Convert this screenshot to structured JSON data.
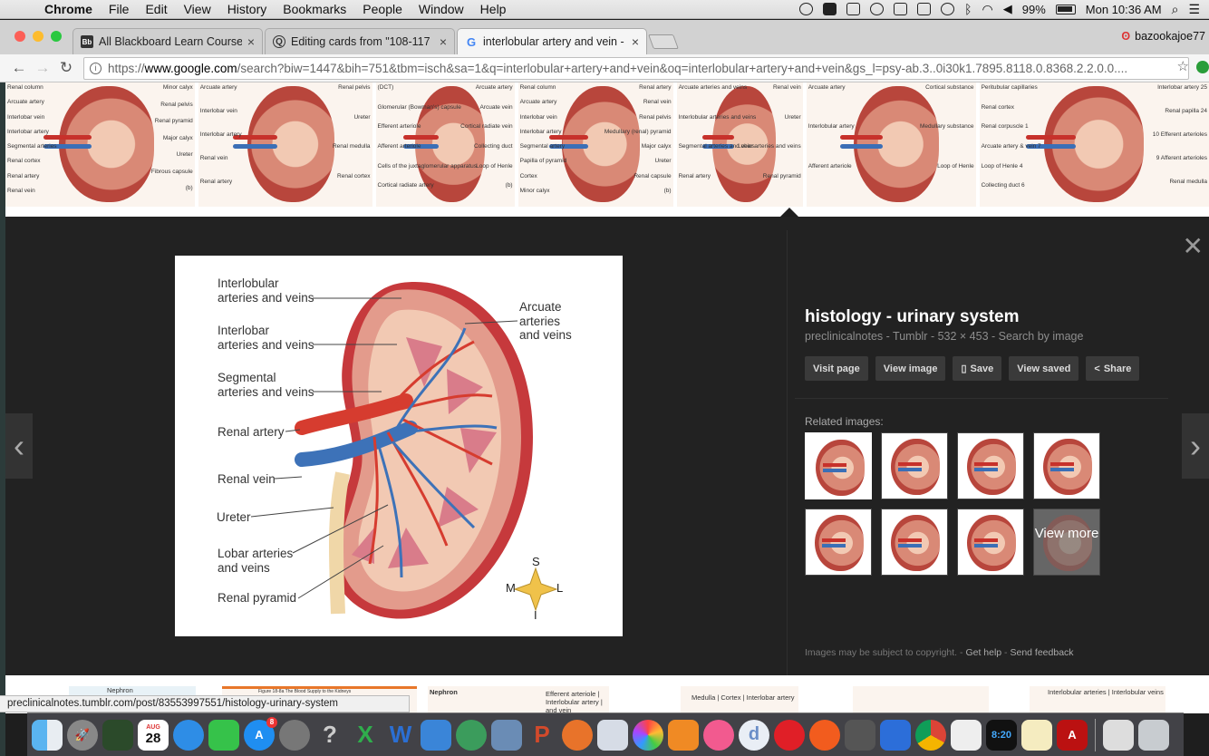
{
  "menubar": {
    "app": "Chrome",
    "items": [
      "File",
      "Edit",
      "View",
      "History",
      "Bookmarks",
      "People",
      "Window",
      "Help"
    ],
    "battery": "99%",
    "clock": "Mon 10:36 AM"
  },
  "tabs": [
    {
      "title": "All Blackboard Learn Courses",
      "favicon": "Bb"
    },
    {
      "title": "Editing cards from \"108-117",
      "favicon": "Q"
    },
    {
      "title": "interlobular artery and vein - G",
      "favicon": "G"
    }
  ],
  "profile": "bazookajoe77",
  "omnibox": {
    "scheme": "https://",
    "host": "www.google.com",
    "path": "/search?biw=1447&bih=751&tbm=isch&sa=1&q=interlobular+artery+and+vein&oq=interlobular+artery+and+vein&gs_l=psy-ab.3..0i30k1.7895.8118.0.8368.2.2.0.0...."
  },
  "top_thumbnails": [
    {
      "labels": [
        "Renal column",
        "Arcuate artery",
        "Interlobar vein",
        "Interlobar artery",
        "Segmental arteries",
        "Renal cortex",
        "Renal artery",
        "Renal vein",
        "Minor calyx",
        "Renal pelvis",
        "Renal pyramid",
        "Major calyx",
        "Ureter",
        "Fibrous capsule",
        "(b)"
      ]
    },
    {
      "labels": [
        "Arcuate artery",
        "Interlobar vein",
        "Interlobar artery",
        "Renal vein",
        "Renal artery",
        "Renal pelvis",
        "Ureter",
        "Renal medulla",
        "Renal cortex"
      ]
    },
    {
      "labels": [
        "(DCT)",
        "Glomerular (Bowman's) capsule",
        "Efferent arteriole",
        "Afferent arteriole",
        "Cells of the juxtaglomerular apparatus",
        "Cortical radiate artery",
        "Arcuate artery",
        "Arcuate vein",
        "Cortical radiate vein",
        "Collecting duct",
        "Loop of Henle",
        "(b)"
      ]
    },
    {
      "labels": [
        "Renal column",
        "Arcuate artery",
        "Interlobar vein",
        "Interlobar artery",
        "Segmental artery",
        "Papilla of pyramid",
        "Cortex",
        "Minor calyx",
        "Renal artery",
        "Renal vein",
        "Renal pelvis",
        "Medullary (renal) pyramid",
        "Major calyx",
        "Ureter",
        "Renal capsule",
        "(b)"
      ]
    },
    {
      "labels": [
        "Arcuate arteries and veins",
        "Interlobular arteries and veins",
        "Segmental arteries and veins",
        "Renal artery",
        "Renal vein",
        "Ureter",
        "Lobar arteries and veins",
        "Renal pyramid"
      ]
    },
    {
      "labels": [
        "Arcuate artery",
        "Interlobular artery",
        "Afferent arteriole",
        "Cortical substance",
        "Medullary substance",
        "Loop of Henle"
      ]
    },
    {
      "labels": [
        "Peritubular capillaries",
        "Renal cortex",
        "Renal corpuscle 1",
        "Arcuate artery & vein 7",
        "Loop of Henle 4",
        "Collecting duct 6",
        "Interlobar artery 25",
        "Renal papilla 24",
        "10 Efferent arterioles",
        "9 Afferent arterioles",
        "Renal medulla"
      ]
    }
  ],
  "viewer": {
    "title": "histology - urinary system",
    "meta": "preclinicalnotes - Tumblr - 532 × 453 - Search by image",
    "buttons": [
      "Visit page",
      "View image",
      "Save",
      "View saved",
      "Share"
    ],
    "related_label": "Related images:",
    "view_more": "View more",
    "copyright": "Images may be subject to copyright.",
    "help": "Get help",
    "feedback": "Send feedback"
  },
  "main_image": {
    "labels": {
      "interlobular": [
        "Interlobular",
        "arteries and veins"
      ],
      "interlobar": [
        "Interlobar",
        "arteries and veins"
      ],
      "segmental": [
        "Segmental",
        "arteries and veins"
      ],
      "renal_artery": "Renal artery",
      "renal_vein": "Renal vein",
      "ureter": "Ureter",
      "lobar": [
        "Lobar arteries",
        "and veins"
      ],
      "renal_pyramid": "Renal pyramid",
      "arcuate": [
        "Arcuate",
        "arteries",
        "and veins"
      ],
      "compass": {
        "s": "S",
        "m": "M",
        "l": "L",
        "i": "I"
      }
    }
  },
  "bottom_thumbnails": [
    {
      "text": "Nephron"
    },
    {
      "text": "Figure 18-8a  The Blood Supply to the Kidneys"
    },
    {
      "text": "Nephron",
      "extra": "Efferent arteriole | Interlobular artery | and vein"
    },
    {
      "text": "Medulla | Cortex | Interlobar artery"
    },
    {
      "text": ""
    },
    {
      "text": "Interlobular arteries | Interlobular veins"
    }
  ],
  "statusbar": "preclinicalnotes.tumblr.com/post/83553997551/histology-urinary-system",
  "dock": {
    "calendar_month": "AUG",
    "calendar_day": "28",
    "appstore_badge": "8",
    "clock_text": "8:20"
  },
  "colors": {
    "artery": "#d63c2f",
    "vein": "#3d72b8",
    "viewer_bg": "#222222",
    "button_bg": "#3a3a3a"
  }
}
